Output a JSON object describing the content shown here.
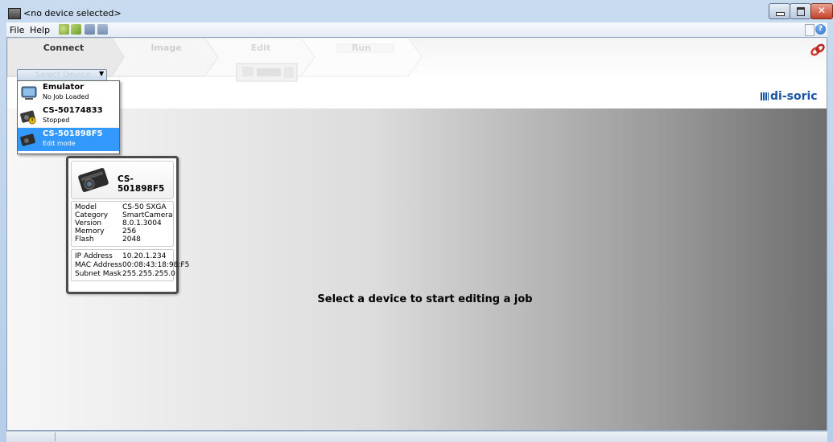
{
  "window": {
    "title": "<no device selected>"
  },
  "menu": {
    "items": [
      "File",
      "Help"
    ]
  },
  "toolbar": {
    "icons": [
      "new-icon",
      "open-icon",
      "save-icon",
      "save-as-icon"
    ],
    "right_icons": [
      "notes-icon",
      "help-icon"
    ]
  },
  "steps": [
    {
      "label": "Connect",
      "state": "active"
    },
    {
      "label": "Image",
      "state": "disabled"
    },
    {
      "label": "Edit",
      "state": "disabled"
    },
    {
      "label": "Run",
      "state": "disabled"
    }
  ],
  "device_select": {
    "placeholder": "Select Device"
  },
  "devices": [
    {
      "name": "Emulator",
      "status": "No Job Loaded"
    },
    {
      "name": "CS-50174833",
      "status": "Stopped"
    },
    {
      "name": "CS-501898F5",
      "status": "Edit mode"
    }
  ],
  "device_card": {
    "name": "CS-501898F5",
    "specs": [
      {
        "label": "Model",
        "value": "CS-50 SXGA"
      },
      {
        "label": "Category",
        "value": "SmartCamera"
      },
      {
        "label": "Version",
        "value": "8.0.1.3004"
      },
      {
        "label": "Memory",
        "value": "256"
      },
      {
        "label": "Flash",
        "value": "2048"
      }
    ],
    "network": [
      {
        "label": "IP Address",
        "value": "10.20.1.234"
      },
      {
        "label": "MAC Address",
        "value": "00:08:43:18:98:F5"
      },
      {
        "label": "Subnet Mask",
        "value": "255.255.255.0"
      }
    ]
  },
  "main": {
    "message": "Select a device to start editing a job"
  },
  "brand": {
    "logo": "di-soric",
    "color": "#1a55a5"
  },
  "colors": {
    "selection": "#3399ff",
    "link_icon": "#d23a2a"
  }
}
